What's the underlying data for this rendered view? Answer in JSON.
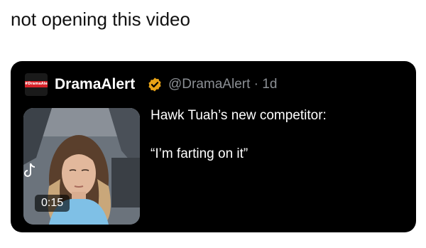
{
  "caption": "not opening this video",
  "tweet": {
    "avatar_logo_text": "#DramaAlert",
    "display_name": "DramaAlert",
    "verified_badge_icon": "verified-badge-icon",
    "badge_color": "#e8a317",
    "handle": "@DramaAlert",
    "separator": " · ",
    "age": "1d",
    "handle_meta": "@DramaAlert · 1d",
    "text_line_1": "Hawk Tuah’s new competitor:",
    "text_line_2": "“I’m farting on it”",
    "media": {
      "duration": "0:15",
      "watermark_icon": "tiktok-icon"
    }
  },
  "colors": {
    "card_background": "#000000",
    "primary_text": "#ffffff",
    "secondary_text": "#8b8f94",
    "brand_red": "#d8232a"
  }
}
